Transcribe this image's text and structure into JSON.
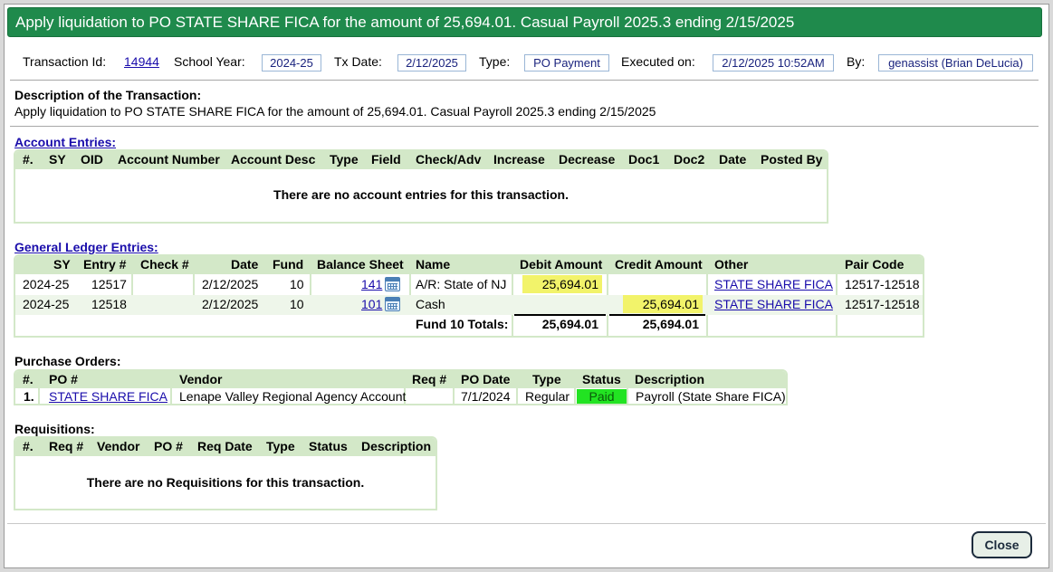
{
  "title": "Apply liquidation to PO STATE SHARE FICA for the amount of 25,694.01. Casual Payroll 2025.3 ending 2/15/2025",
  "header": {
    "transaction_id_label": "Transaction Id:",
    "transaction_id": "14944",
    "school_year_label": "School Year:",
    "school_year": "2024-25",
    "tx_date_label": "Tx Date:",
    "tx_date": "2/12/2025",
    "type_label": "Type:",
    "type": "PO Payment",
    "executed_on_label": "Executed on:",
    "executed_on": "2/12/2025 10:52AM",
    "by_label": "By:",
    "by": "genassist (Brian DeLucia)"
  },
  "description": {
    "label": "Description of the Transaction:",
    "text": "Apply liquidation to PO STATE SHARE FICA for the amount of 25,694.01. Casual Payroll 2025.3 ending 2/15/2025"
  },
  "account_entries": {
    "title": "Account Entries:",
    "columns": [
      "#.",
      "SY",
      "OID",
      "Account Number",
      "Account Desc",
      "Type",
      "Field",
      "Check/Adv",
      "Increase",
      "Decrease",
      "Doc1",
      "Doc2",
      "Date",
      "Posted By"
    ],
    "empty_message": "There are no account entries for this transaction."
  },
  "general_ledger": {
    "title": "General Ledger Entries:",
    "columns": [
      "SY",
      "Entry #",
      "Check #",
      "Date",
      "Fund",
      "Balance Sheet",
      "Name",
      "Debit Amount",
      "Credit Amount",
      "Other",
      "Pair Code"
    ],
    "rows": [
      {
        "sy": "2024-25",
        "entry": "12517",
        "check": "",
        "date": "2/12/2025",
        "fund": "10",
        "balance_sheet": "141",
        "name": "A/R: State of NJ",
        "debit": "25,694.01",
        "credit": "",
        "other": "STATE SHARE FICA",
        "pair_code": "12517-12518"
      },
      {
        "sy": "2024-25",
        "entry": "12518",
        "check": "",
        "date": "2/12/2025",
        "fund": "10",
        "balance_sheet": "101",
        "name": "Cash",
        "debit": "",
        "credit": "25,694.01",
        "other": "STATE SHARE FICA",
        "pair_code": "12517-12518"
      }
    ],
    "totals_label": "Fund 10 Totals:",
    "total_debit": "25,694.01",
    "total_credit": "25,694.01"
  },
  "purchase_orders": {
    "title": "Purchase Orders:",
    "columns": [
      "#.",
      "PO #",
      "Vendor",
      "Req #",
      "PO Date",
      "Type",
      "Status",
      "Description"
    ],
    "rows": [
      {
        "num": "1.",
        "po": "STATE SHARE FICA",
        "vendor": "Lenape Valley Regional Agency Account",
        "req": "",
        "po_date": "7/1/2024",
        "type": "Regular",
        "status": "Paid",
        "description": "Payroll (State Share FICA)"
      }
    ]
  },
  "requisitions": {
    "title": "Requisitions:",
    "columns": [
      "#.",
      "Req #",
      "Vendor",
      "PO #",
      "Req Date",
      "Type",
      "Status",
      "Description"
    ],
    "empty_message": "There are no Requisitions for this transaction."
  },
  "close_label": "Close",
  "colors": {
    "title_bar": "#1f8a4c",
    "panel_header": "#d3e8c8",
    "highlight": "#f2f36a",
    "paid": "#22e322",
    "link": "#1a0dab"
  },
  "icons": {
    "balance_sheet": "calendar-icon"
  }
}
